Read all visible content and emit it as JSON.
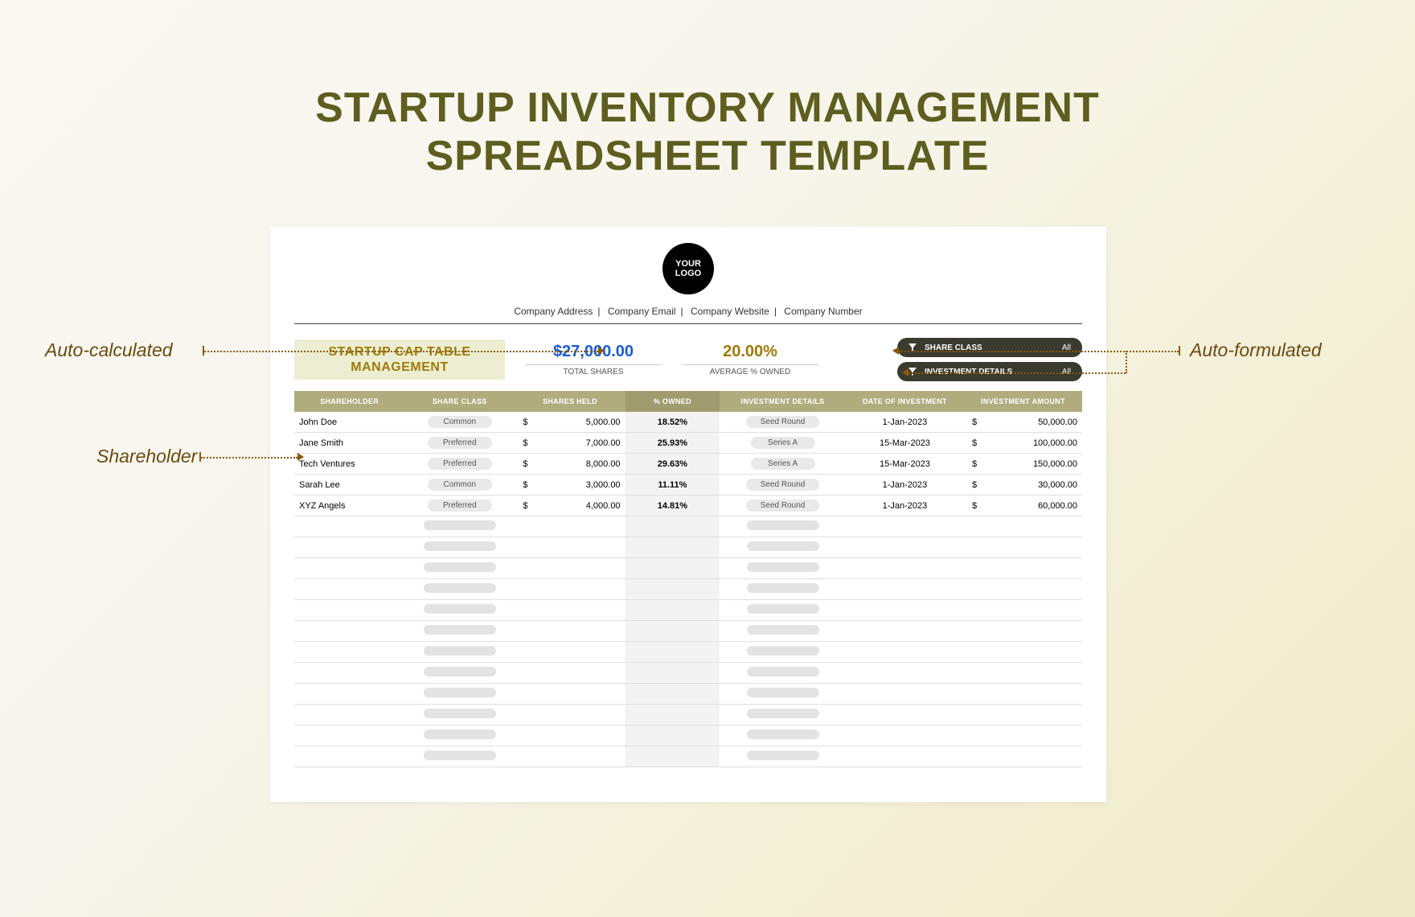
{
  "page_title_line1": "STARTUP INVENTORY MANAGEMENT",
  "page_title_line2": "SPREADSHEET TEMPLATE",
  "logo_text": "YOUR LOGO",
  "company_meta": {
    "address": "Company Address",
    "email": "Company Email",
    "website": "Company Website",
    "number": "Company Number"
  },
  "cap_table_title": "STARTUP CAP TABLE MANAGEMENT",
  "summary": {
    "total_shares_value": "$27,000.00",
    "total_shares_label": "TOTAL SHARES",
    "avg_owned_value": "20.00%",
    "avg_owned_label": "AVERAGE % OWNED"
  },
  "filters": {
    "share_class_label": "SHARE CLASS",
    "share_class_value": "All",
    "investment_details_label": "INVESTMENT DETAILS",
    "investment_details_value": "All"
  },
  "columns": {
    "shareholder": "SHAREHOLDER",
    "share_class": "SHARE CLASS",
    "shares_held": "SHARES HELD",
    "pct_owned": "% OWNED",
    "investment_details": "INVESTMENT DETAILS",
    "date_of_investment": "DATE OF INVESTMENT",
    "investment_amount": "INVESTMENT AMOUNT"
  },
  "rows": [
    {
      "shareholder": "John Doe",
      "share_class": "Common",
      "shares_held": "5,000.00",
      "pct_owned": "18.52%",
      "investment_details": "Seed Round",
      "date": "1-Jan-2023",
      "amount": "50,000.00"
    },
    {
      "shareholder": "Jane Smith",
      "share_class": "Preferred",
      "shares_held": "7,000.00",
      "pct_owned": "25.93%",
      "investment_details": "Series A",
      "date": "15-Mar-2023",
      "amount": "100,000.00"
    },
    {
      "shareholder": "Tech Ventures",
      "share_class": "Preferred",
      "shares_held": "8,000.00",
      "pct_owned": "29.63%",
      "investment_details": "Series A",
      "date": "15-Mar-2023",
      "amount": "150,000.00"
    },
    {
      "shareholder": "Sarah Lee",
      "share_class": "Common",
      "shares_held": "3,000.00",
      "pct_owned": "11.11%",
      "investment_details": "Seed Round",
      "date": "1-Jan-2023",
      "amount": "30,000.00"
    },
    {
      "shareholder": "XYZ Angels",
      "share_class": "Preferred",
      "shares_held": "4,000.00",
      "pct_owned": "14.81%",
      "investment_details": "Seed Round",
      "date": "1-Jan-2023",
      "amount": "60,000.00"
    }
  ],
  "empty_row_count": 12,
  "callouts": {
    "auto_calculated": "Auto-calculated",
    "shareholder": "Shareholder",
    "auto_formulated": "Auto-formulated"
  }
}
